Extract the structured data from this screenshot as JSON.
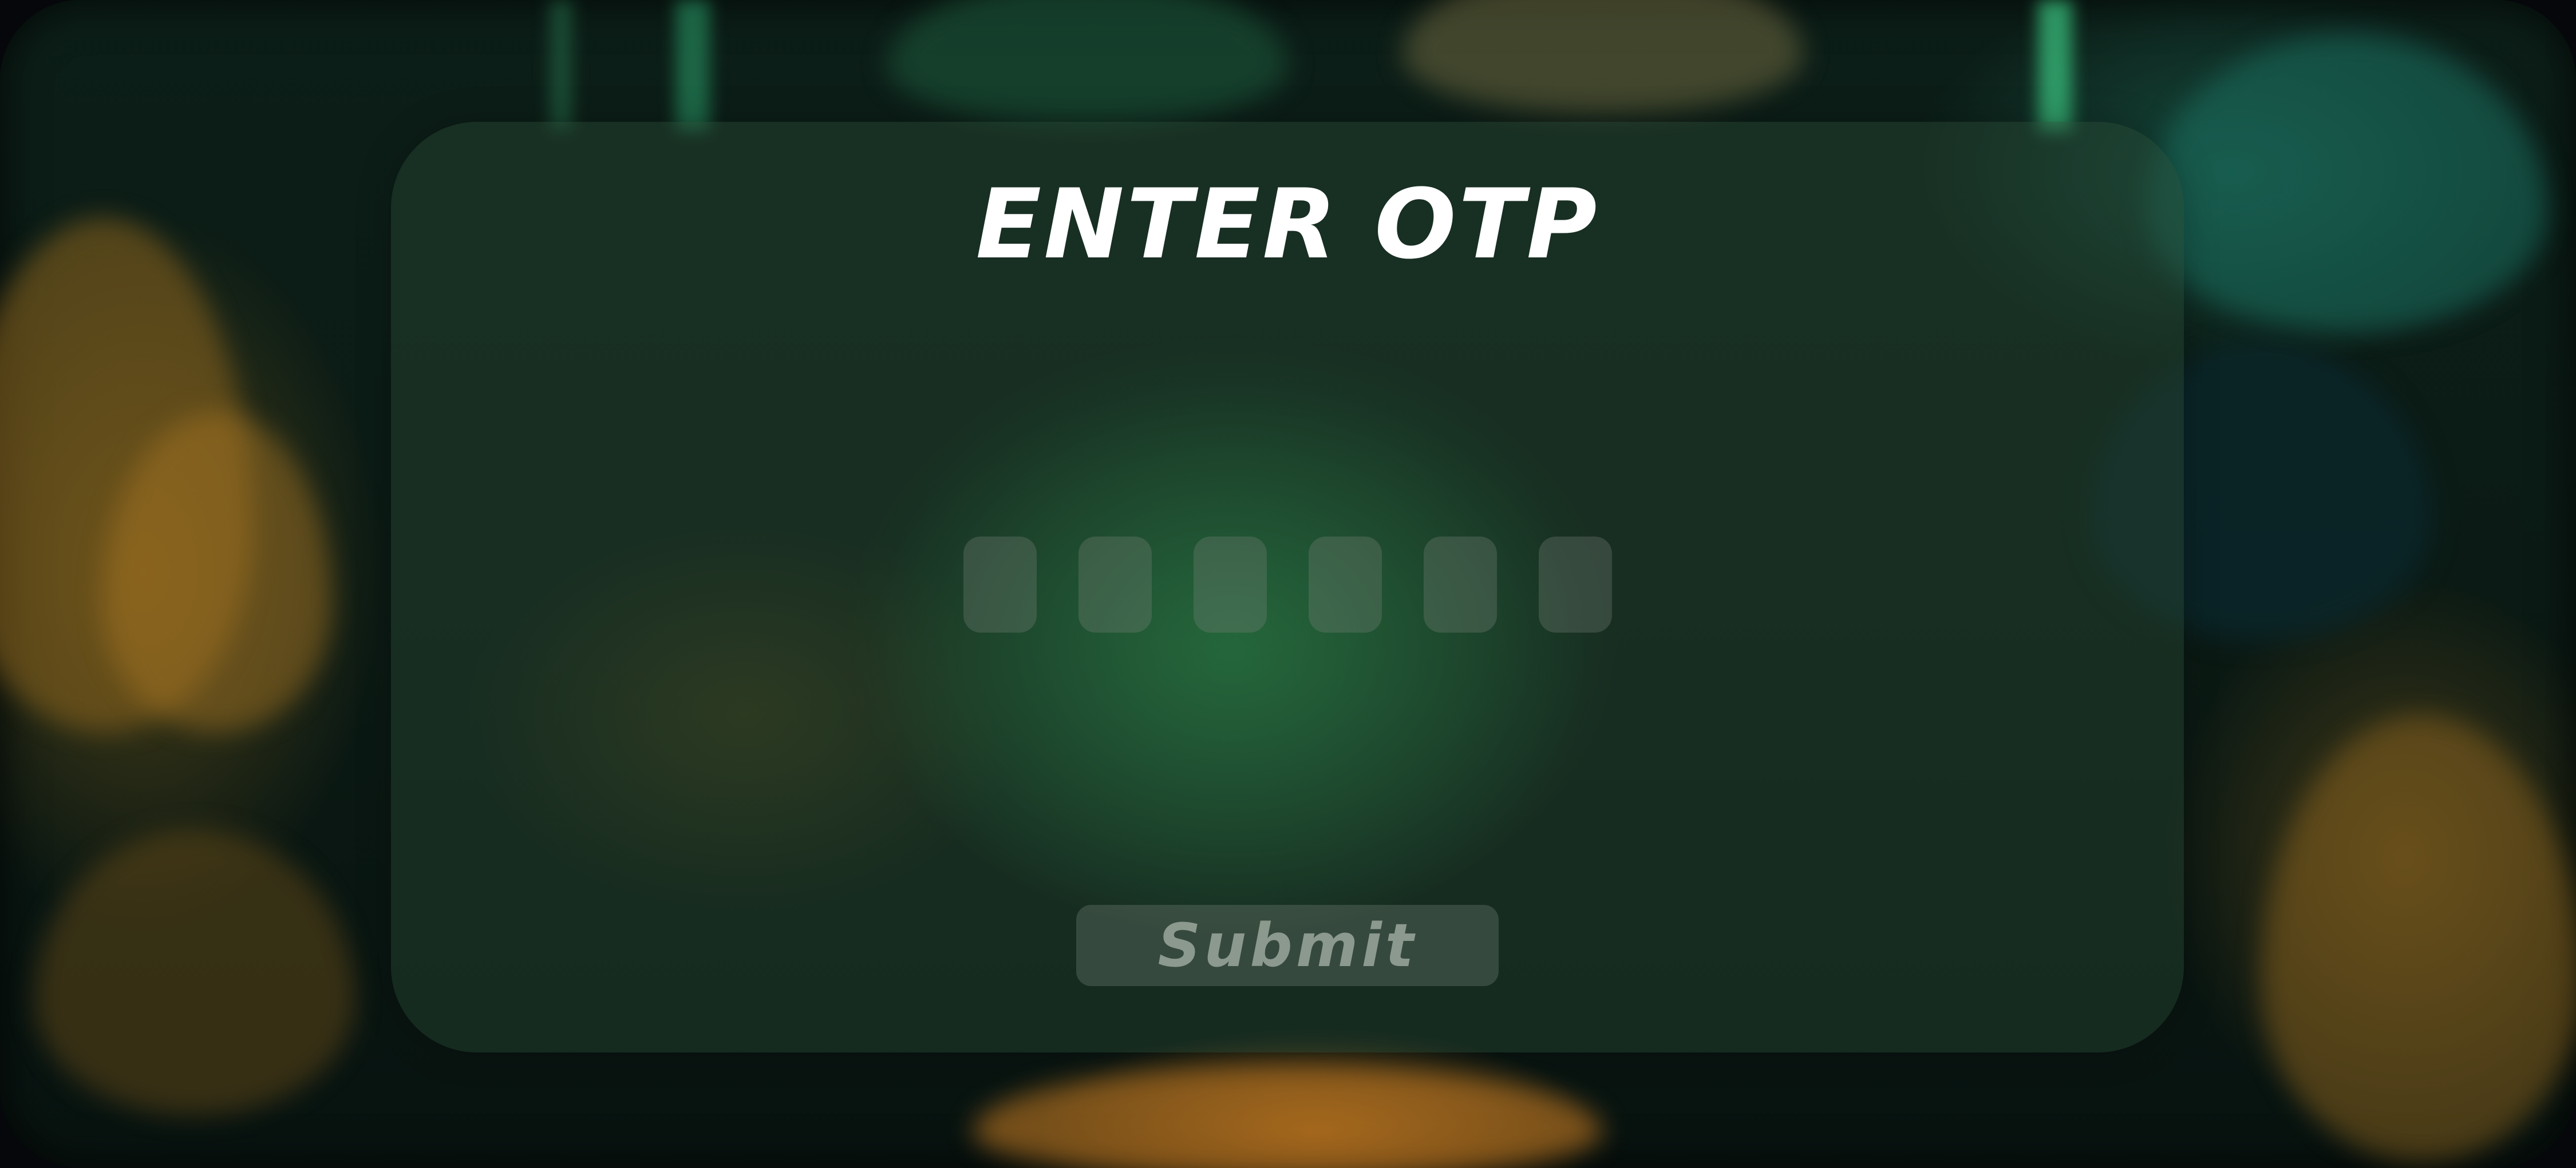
{
  "dialog": {
    "title": "ENTER OTP",
    "otp_digits": [
      "",
      "",
      "",
      "",
      "",
      ""
    ],
    "submit_label": "Submit"
  },
  "colors": {
    "panel": "#2a4634",
    "otp_box": "#5e6b61",
    "title": "#ffffff",
    "submit_text": "#9aa69c"
  }
}
